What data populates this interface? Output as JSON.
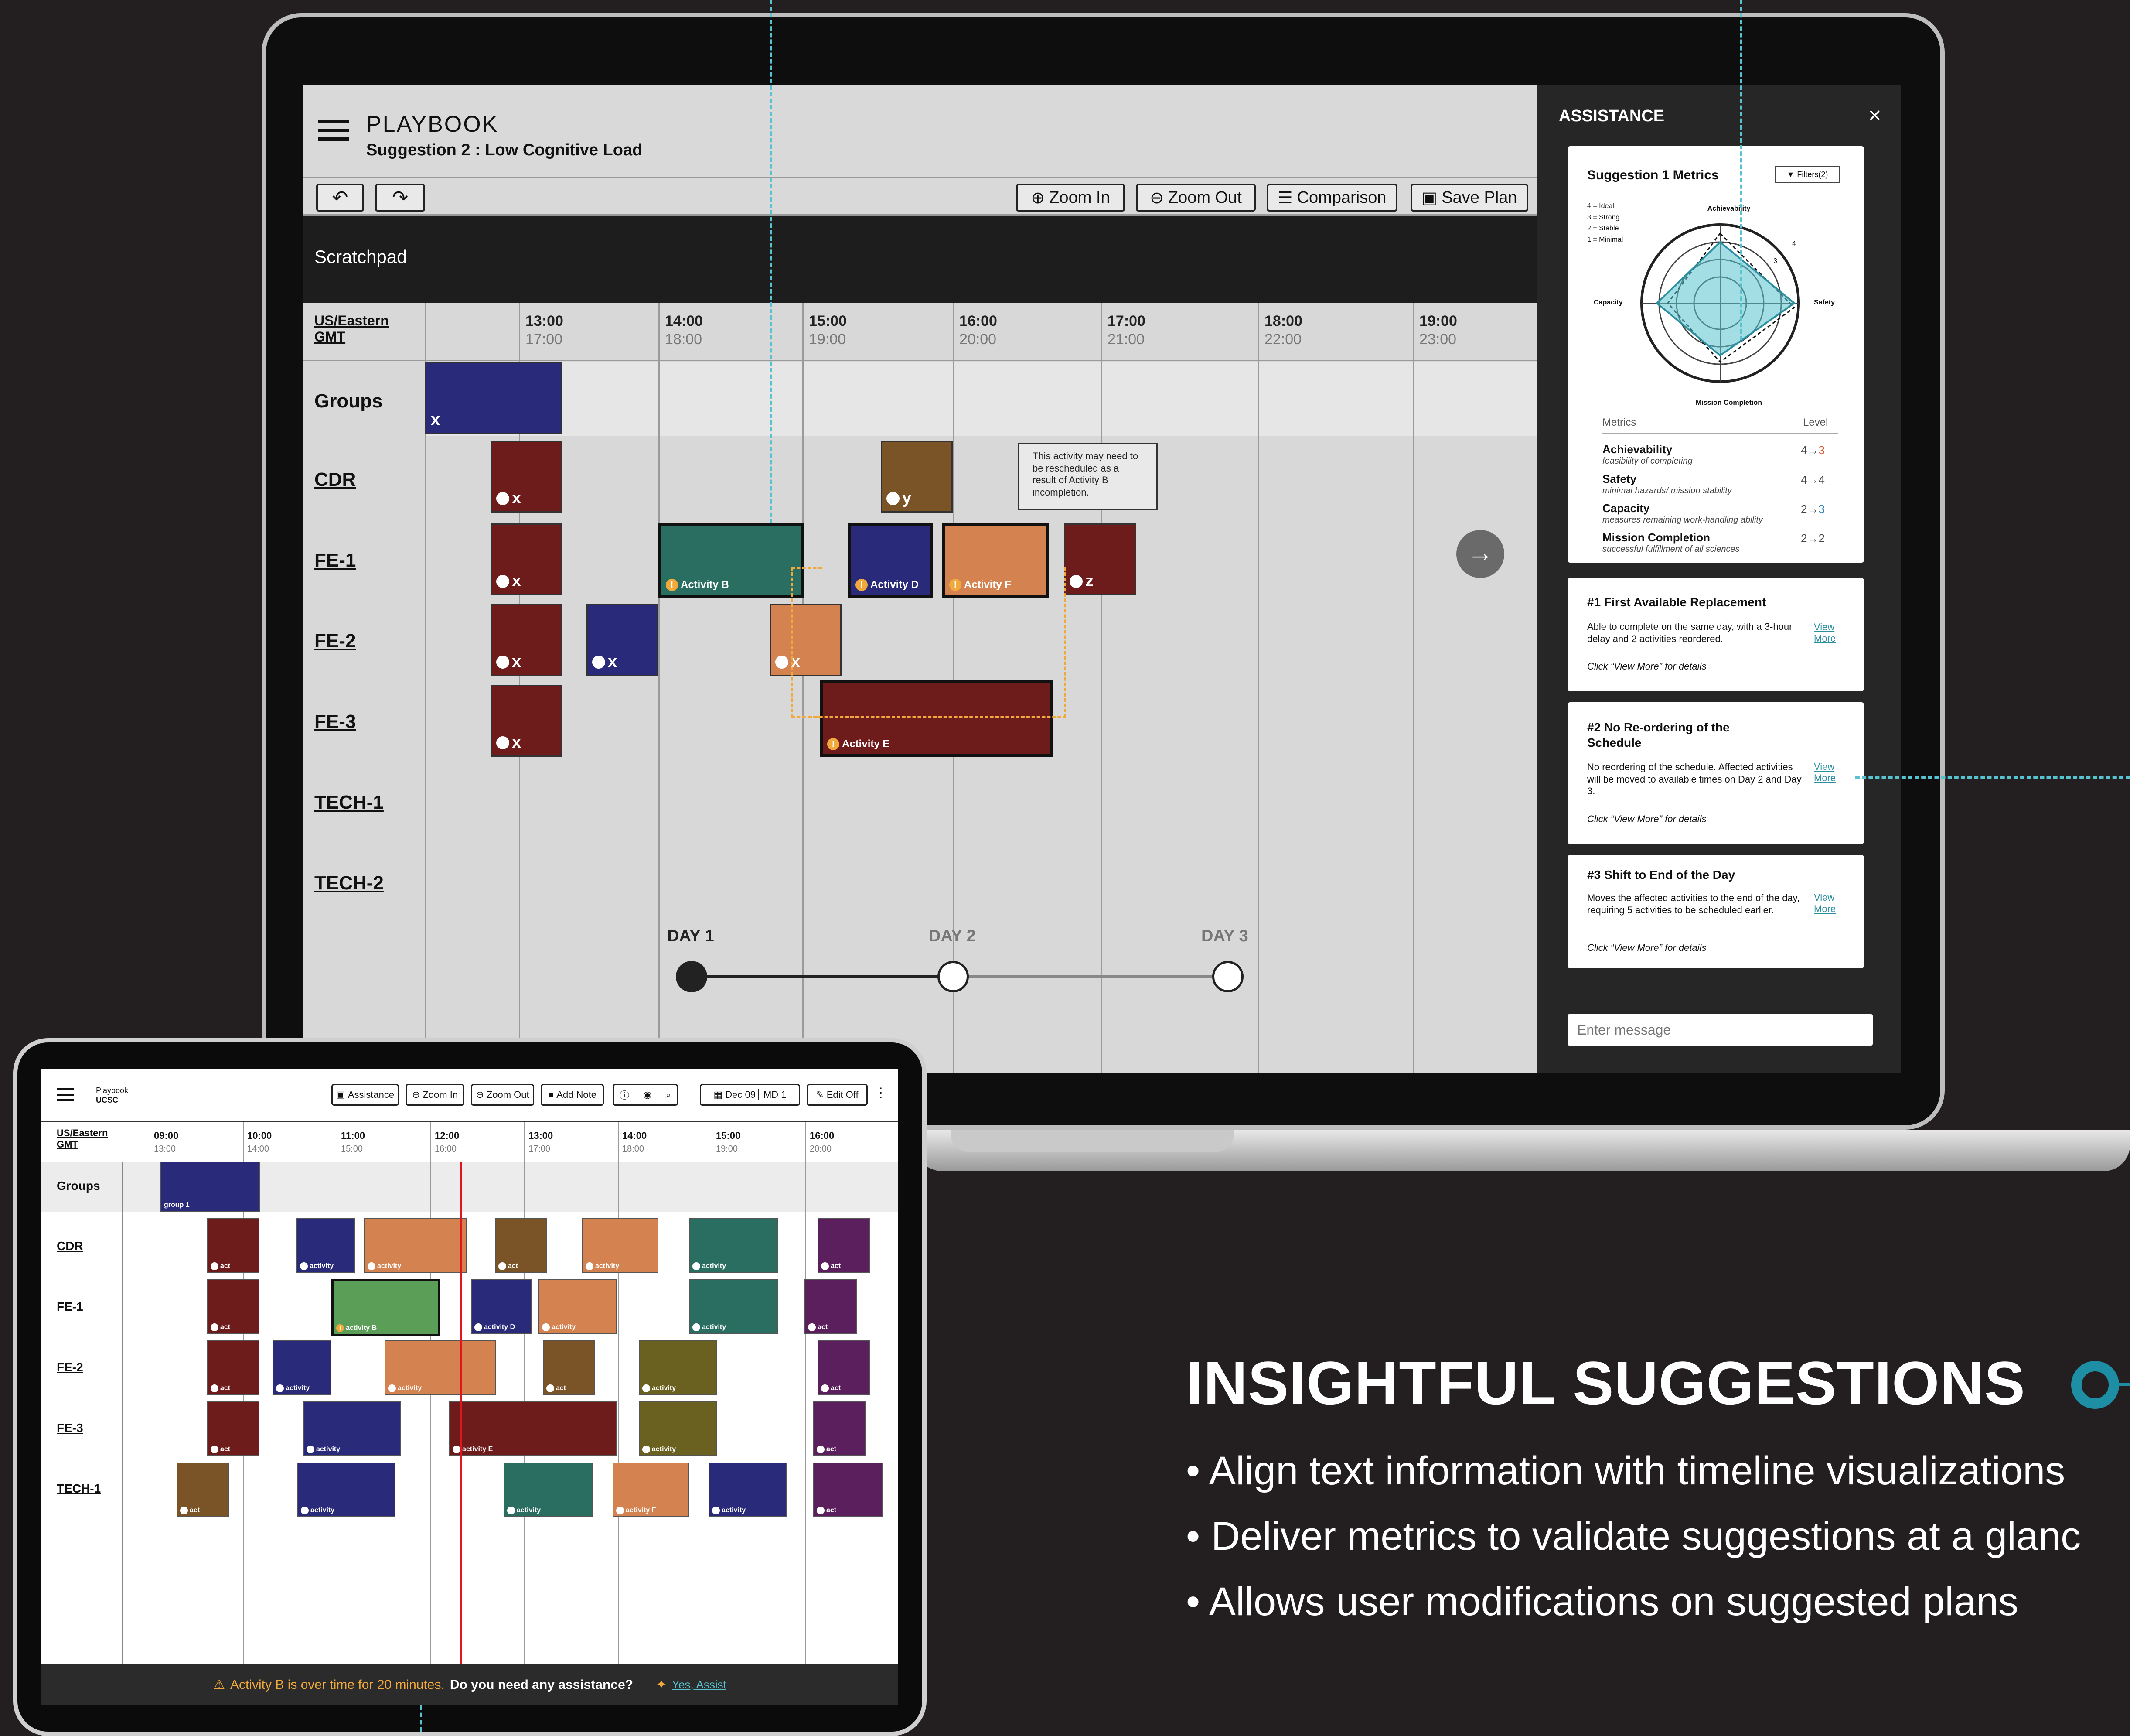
{
  "laptop": {
    "brand": "PLAYBOOK",
    "subtitle": "Suggestion 2 : Low Cognitive Load",
    "toolbar": {
      "zoom_in": "Zoom In",
      "zoom_out": "Zoom Out",
      "comparison": "Comparison",
      "save_plan": "Save Plan"
    },
    "scratchpad": "Scratchpad",
    "timezone": [
      "US/Eastern",
      "GMT"
    ],
    "times": [
      {
        "top": "13:00",
        "sub": "17:00"
      },
      {
        "top": "14:00",
        "sub": "18:00"
      },
      {
        "top": "15:00",
        "sub": "19:00"
      },
      {
        "top": "16:00",
        "sub": "20:00"
      },
      {
        "top": "17:00",
        "sub": "21:00"
      },
      {
        "top": "18:00",
        "sub": "22:00"
      },
      {
        "top": "19:00",
        "sub": "23:00"
      }
    ],
    "rows": [
      "Groups",
      "CDR",
      "FE-1",
      "FE-2",
      "FE-3",
      "TECH-1",
      "TECH-2"
    ],
    "blocks": {
      "groups_x": "x",
      "cdr_x": "x",
      "cdr_y": "y",
      "fe1_x": "x",
      "fe1_b": "Activity B",
      "fe1_d": "Activity D",
      "fe1_f": "Activity F",
      "fe1_z": "z",
      "fe2_x1": "x",
      "fe2_x2": "x",
      "fe2_x3": "x",
      "fe3_x": "x",
      "fe3_e": "Activity E"
    },
    "tooltip": "This activity may need to be rescheduled as a result of Activity B incompletion.",
    "days": [
      "DAY 1",
      "DAY 2",
      "DAY 3"
    ]
  },
  "assistance": {
    "title": "ASSISTANCE",
    "metrics_title": "Suggestion 1 Metrics",
    "filters": "Filters(2)",
    "legend": [
      "4 = Ideal",
      "3 = Strong",
      "2 = Stable",
      "1 = Minimal"
    ],
    "axes": {
      "top": "Achievability",
      "right": "Safety",
      "bottom": "Mission Completion",
      "left": "Capacity"
    },
    "ring_labels": [
      "4",
      "3"
    ],
    "col_metrics": "Metrics",
    "col_level": "Level",
    "metrics": [
      {
        "name": "Achievability",
        "desc": "feasibility of completing",
        "from": "4",
        "to": "3"
      },
      {
        "name": "Safety",
        "desc": "minimal hazards/ mission stability",
        "from": "4",
        "to": "4"
      },
      {
        "name": "Capacity",
        "desc": "measures remaining work-handling ability",
        "from": "2",
        "to": "3"
      },
      {
        "name": "Mission Completion",
        "desc": "successful fulfillment of all sciences",
        "from": "2",
        "to": "2"
      }
    ],
    "suggestions": [
      {
        "title": "#1 First Available Replacement",
        "body": "Able to complete on the same day, with a 3-hour delay and 2 activities reordered.",
        "hint": "Click “View More” for details",
        "link": "View More"
      },
      {
        "title": "#2 No Re-ordering of the Schedule",
        "body": "No reordering of the schedule. Affected activities will be moved to available times on Day 2 and Day 3.",
        "hint": "Click “View More” for details",
        "link": "View More"
      },
      {
        "title": "#3 Shift to End of the Day",
        "body": "Moves the affected activities to the end of the day, requiring 5 activities to be scheduled earlier.",
        "hint": "Click “View More” for details",
        "link": "View More"
      }
    ],
    "message_placeholder": "Enter message"
  },
  "tablet": {
    "brand": "Playbook",
    "org": "UCSC",
    "buttons": {
      "assistance": "Assistance",
      "zoom_in": "Zoom In",
      "zoom_out": "Zoom Out",
      "add_note": "Add Note",
      "date": "Dec 09",
      "md": "MD 1",
      "edit": "Edit Off"
    },
    "timezone": [
      "US/Eastern",
      "GMT"
    ],
    "times": [
      {
        "top": "09:00",
        "sub": "13:00"
      },
      {
        "top": "10:00",
        "sub": "14:00"
      },
      {
        "top": "11:00",
        "sub": "15:00"
      },
      {
        "top": "12:00",
        "sub": "16:00"
      },
      {
        "top": "13:00",
        "sub": "17:00"
      },
      {
        "top": "14:00",
        "sub": "18:00"
      },
      {
        "top": "15:00",
        "sub": "19:00"
      },
      {
        "top": "16:00",
        "sub": "20:00"
      }
    ],
    "rows": [
      "Groups",
      "CDR",
      "FE-1",
      "FE-2",
      "FE-3",
      "TECH-1"
    ],
    "labels": {
      "group": "group 1",
      "act": "act",
      "activity": "activity",
      "b": "activity B",
      "d": "activity D",
      "e": "activity E",
      "f": "activity F"
    },
    "alert": {
      "warning": "Activity B is over time for 20 minutes.",
      "question": "Do you need any assistance?",
      "action": "Yes, Assist"
    }
  },
  "marketing": {
    "heading": "INSIGHTFUL SUGGESTIONS",
    "bullets": [
      "Align text information with timeline visualizations",
      "Deliver metrics to validate suggestions at a glanc",
      "Allows user modifications on suggested plans"
    ]
  },
  "colors": {
    "navy": "#2a2a7a",
    "maroon": "#6e1b1b",
    "teal": "#2a6e62",
    "orange": "#d4824f",
    "brown": "#7a5426",
    "accent": "#58c3d0",
    "alert": "#f0a93a"
  }
}
